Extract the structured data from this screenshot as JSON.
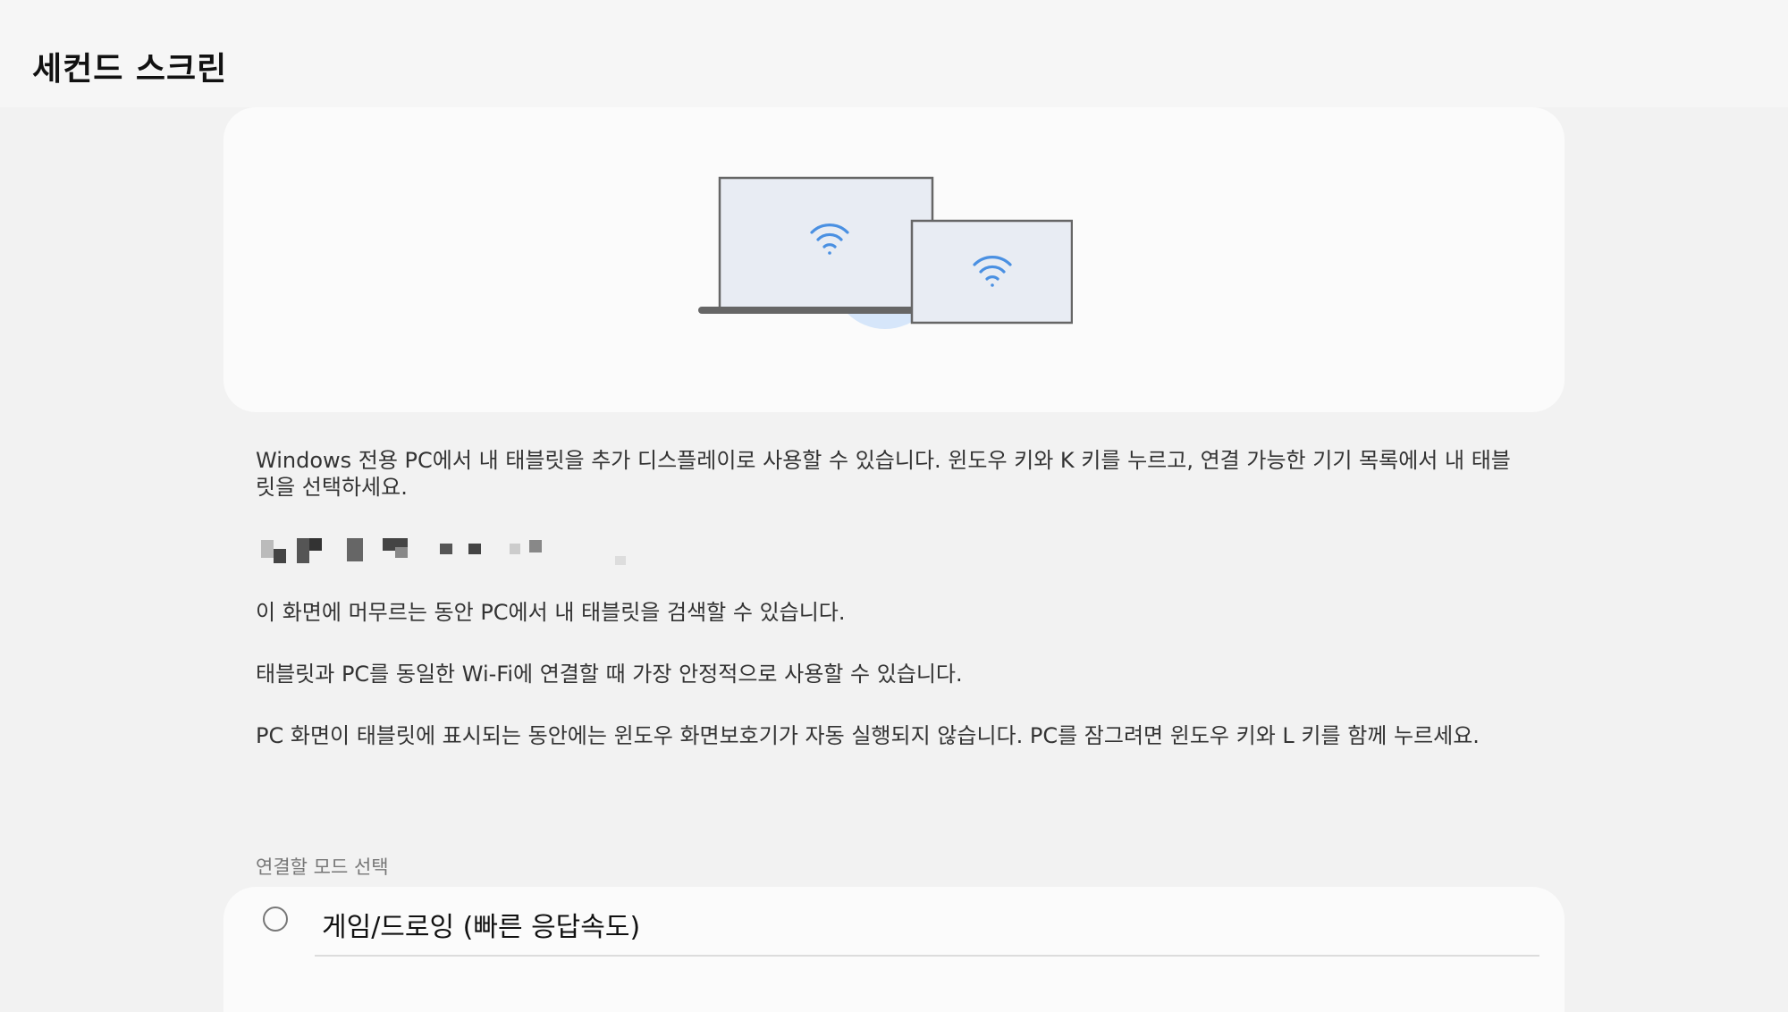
{
  "header": {
    "title": "세컨드 스크린"
  },
  "description": {
    "intro": "Windows 전용 PC에서 내 태블릿을 추가 디스플레이로 사용할 수 있습니다. 윈도우 키와 K 키를 누르고, 연결 가능한 기기 목록에서 내 태블릿을 선택하세요.",
    "search_note": "이 화면에 머무르는 동안 PC에서 내 태블릿을 검색할 수 있습니다.",
    "wifi_note": "태블릿과 PC를 동일한 Wi-Fi에 연결할 때 가장 안정적으로 사용할 수 있습니다.",
    "screensaver_note": "PC 화면이 태블릿에 표시되는 동안에는 윈도우 화면보호기가 자동 실행되지 않습니다. PC를 잠그려면 윈도우 키와 L 키를 함께 누르세요."
  },
  "mode_selection": {
    "header": "연결할 모드 선택",
    "options": [
      {
        "label": "게임/드로잉 (빠른 응답속도)",
        "selected": false
      }
    ]
  },
  "icons": {
    "illustration": "laptop-tablet-wifi-icon",
    "wifi": "wifi-icon"
  },
  "colors": {
    "accent": "#4a90e2",
    "accent_light": "#d6e6fa",
    "device_outline": "#666666",
    "device_screen": "#e8ecf3"
  }
}
